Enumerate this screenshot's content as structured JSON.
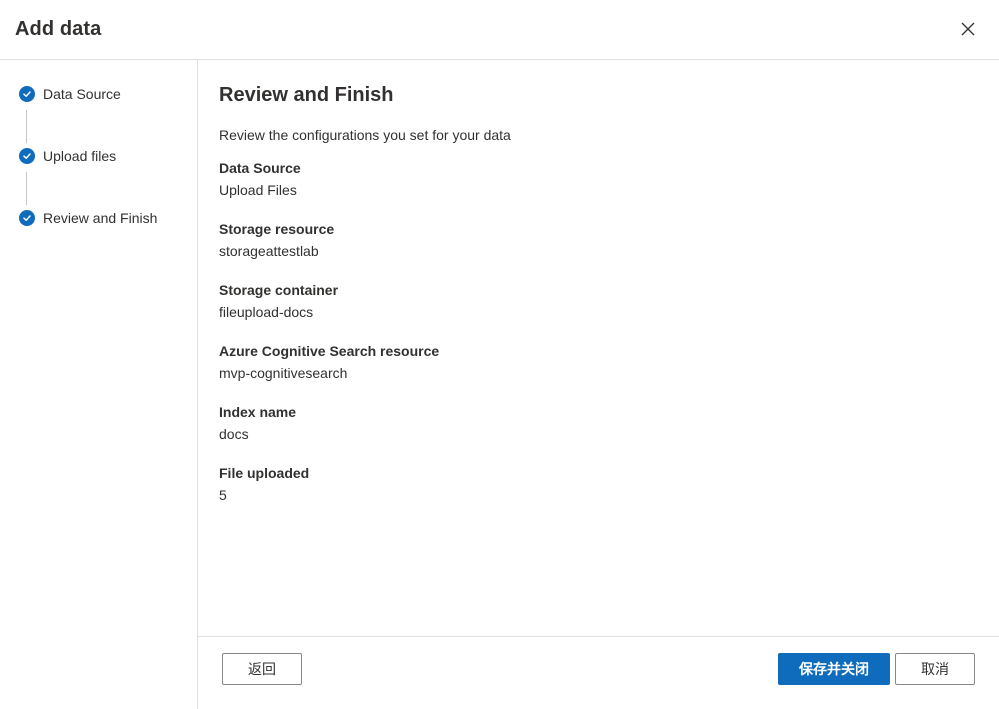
{
  "dialog": {
    "title": "Add data",
    "close_label": "✕"
  },
  "steps": [
    {
      "label": "Data Source",
      "status": "complete"
    },
    {
      "label": "Upload files",
      "status": "complete"
    },
    {
      "label": "Review and Finish",
      "status": "current"
    }
  ],
  "main": {
    "title": "Review and Finish",
    "subtitle": "Review the configurations you set for your data",
    "fields": [
      {
        "label": "Data Source",
        "value": "Upload Files"
      },
      {
        "label": "Storage resource",
        "value": "storageattestlab"
      },
      {
        "label": "Storage container",
        "value": "fileupload-docs"
      },
      {
        "label": "Azure Cognitive Search resource",
        "value": "mvp-cognitivesearch"
      },
      {
        "label": "Index name",
        "value": "docs"
      },
      {
        "label": "File uploaded",
        "value": "5"
      }
    ]
  },
  "footer": {
    "back_label": "返回",
    "primary_label": "保存并关闭",
    "cancel_label": "取消"
  },
  "colors": {
    "accent": "#0f6cbd",
    "border": "#e1dfdd",
    "text": "#323130"
  },
  "icons": {
    "close": "close-icon",
    "step_done": "checkmark-icon"
  }
}
